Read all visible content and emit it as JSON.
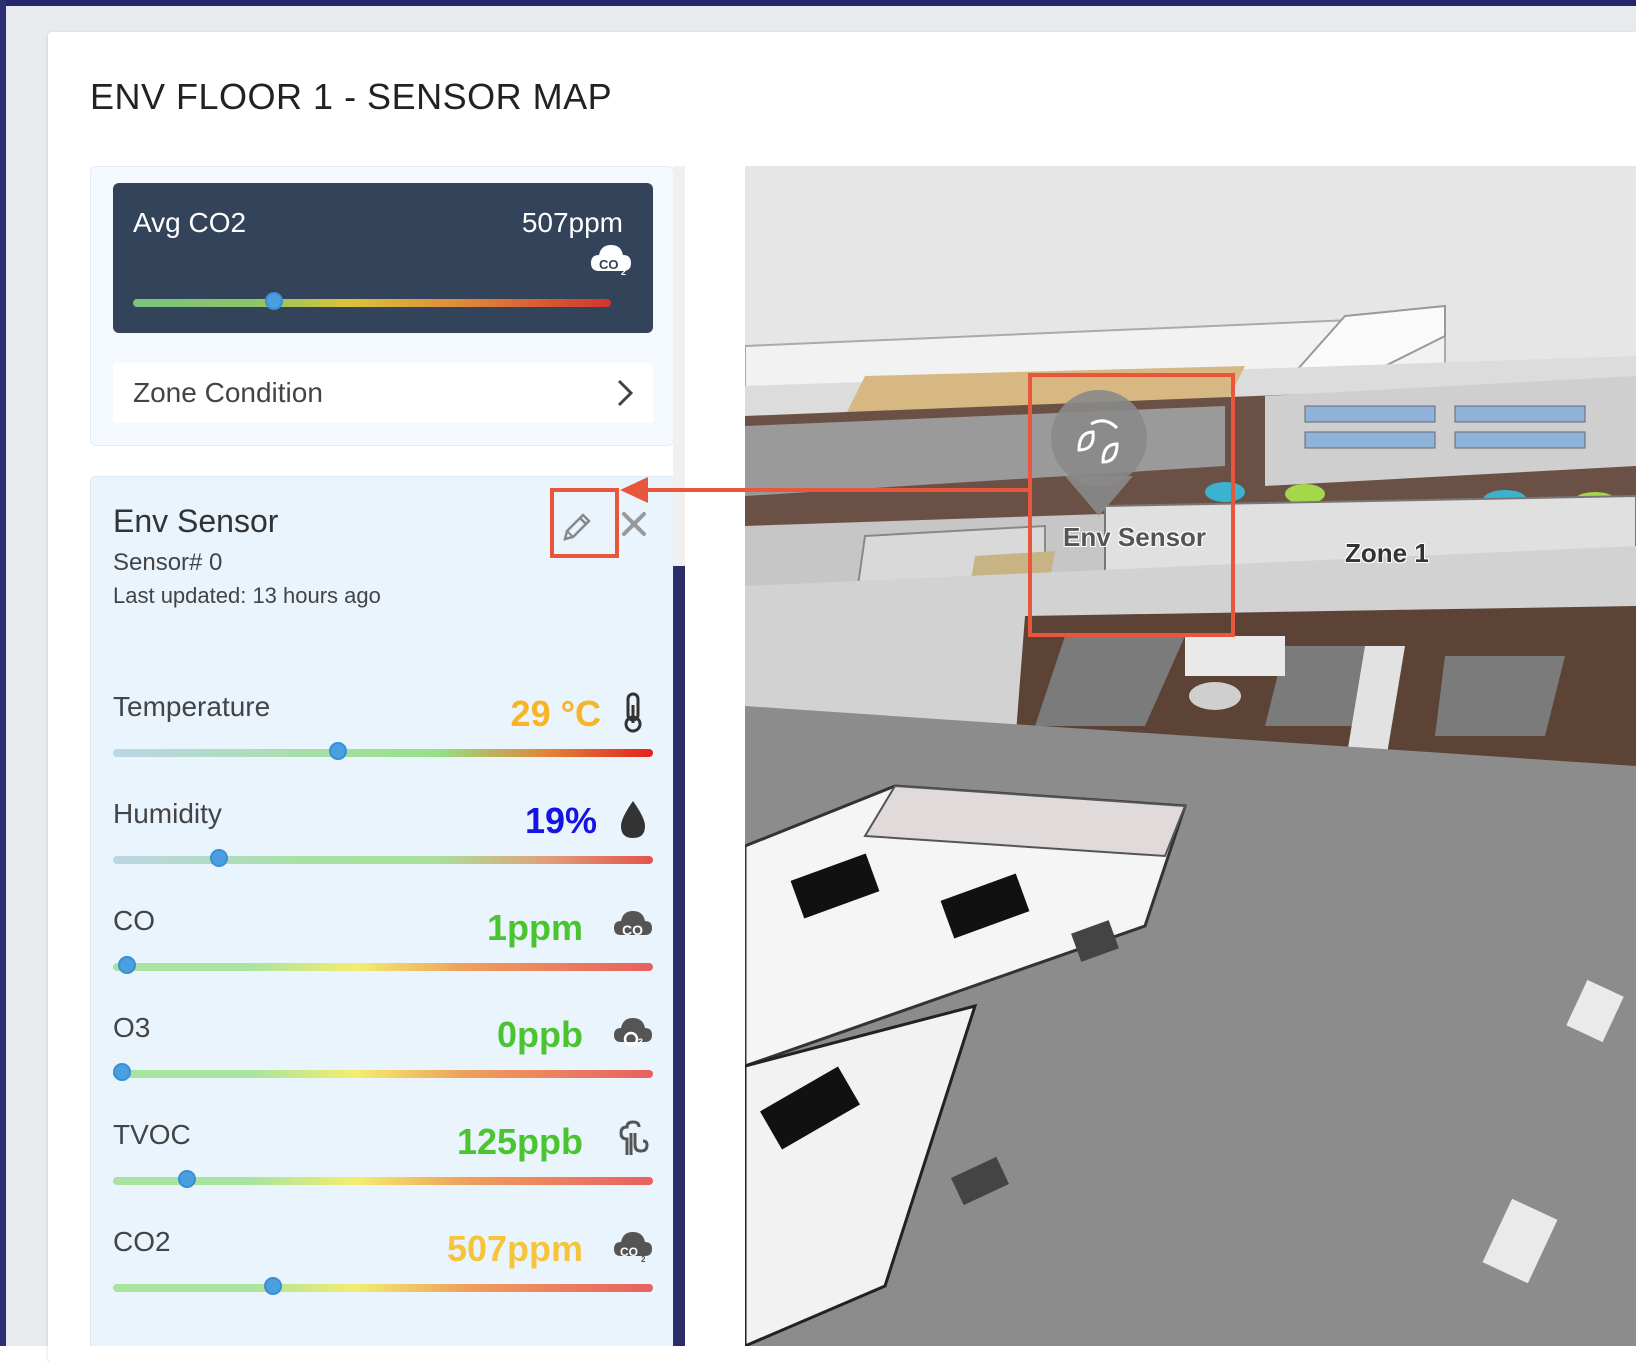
{
  "page": {
    "title": "ENV FLOOR 1 - SENSOR MAP"
  },
  "summary": {
    "avg_label": "Avg CO2",
    "avg_value": "507ppm",
    "avg_level": 0.3,
    "avg_icon": "co2-cloud-icon",
    "zone_condition_label": "Zone Condition"
  },
  "sensor": {
    "name": "Env Sensor",
    "number": "Sensor# 0",
    "last_updated": "Last updated: 13 hours ago",
    "metrics": [
      {
        "label": "Temperature",
        "value": "29 °C",
        "color": "#f6b526",
        "level": 0.42,
        "icon": "thermometer-icon"
      },
      {
        "label": "Humidity",
        "value": "19%",
        "color": "#1414e6",
        "level": 0.2,
        "icon": "water-drop-icon"
      },
      {
        "label": "CO",
        "value": "1ppm",
        "color": "#4cc432",
        "level": 0.03,
        "icon": "co-cloud-icon"
      },
      {
        "label": "O3",
        "value": "0ppb",
        "color": "#4cc432",
        "level": 0.02,
        "icon": "o3-cloud-icon"
      },
      {
        "label": "TVOC",
        "value": "125ppb",
        "color": "#4cc432",
        "level": 0.14,
        "icon": "tvoc-icon"
      },
      {
        "label": "CO2",
        "value": "507ppm",
        "color": "#f6c43a",
        "level": 0.3,
        "icon": "co2-cloud-icon"
      }
    ]
  },
  "map": {
    "pin_label": "Env Sensor",
    "zone_label": "Zone 1",
    "pin_icon": "leaves-icon"
  },
  "colors": {
    "accent": "#e8563b",
    "dark_card": "#334359",
    "knob": "#4a9fe0"
  }
}
